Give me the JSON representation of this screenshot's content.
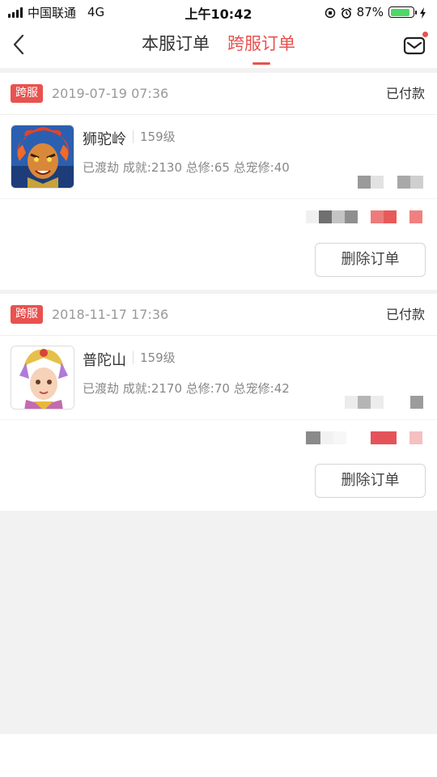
{
  "status_bar": {
    "carrier": "中国联通",
    "network": "4G",
    "time": "上午10:42",
    "battery_percent": "87%",
    "battery_level": 0.87,
    "battery_color": "#4cd964"
  },
  "header": {
    "back_icon": "chevron-left-icon",
    "tabs": [
      {
        "label": "本服订单",
        "active": false
      },
      {
        "label": "跨服订单",
        "active": true
      }
    ],
    "message_icon": "envelope-icon",
    "accent_color": "#e8524f"
  },
  "orders": [
    {
      "tag": "跨服",
      "datetime": "2019-07-19 07:36",
      "status": "已付款",
      "character": {
        "name": "狮驼岭",
        "level": "159级",
        "stats": "已渡劫 成就:2130 总修:65 总宠修:40"
      },
      "delete_label": "删除订单"
    },
    {
      "tag": "跨服",
      "datetime": "2018-11-17 17:36",
      "status": "已付款",
      "character": {
        "name": "普陀山",
        "level": "159级",
        "stats": "已渡劫 成就:2170 总修:70 总宠修:42"
      },
      "delete_label": "删除订单"
    }
  ]
}
